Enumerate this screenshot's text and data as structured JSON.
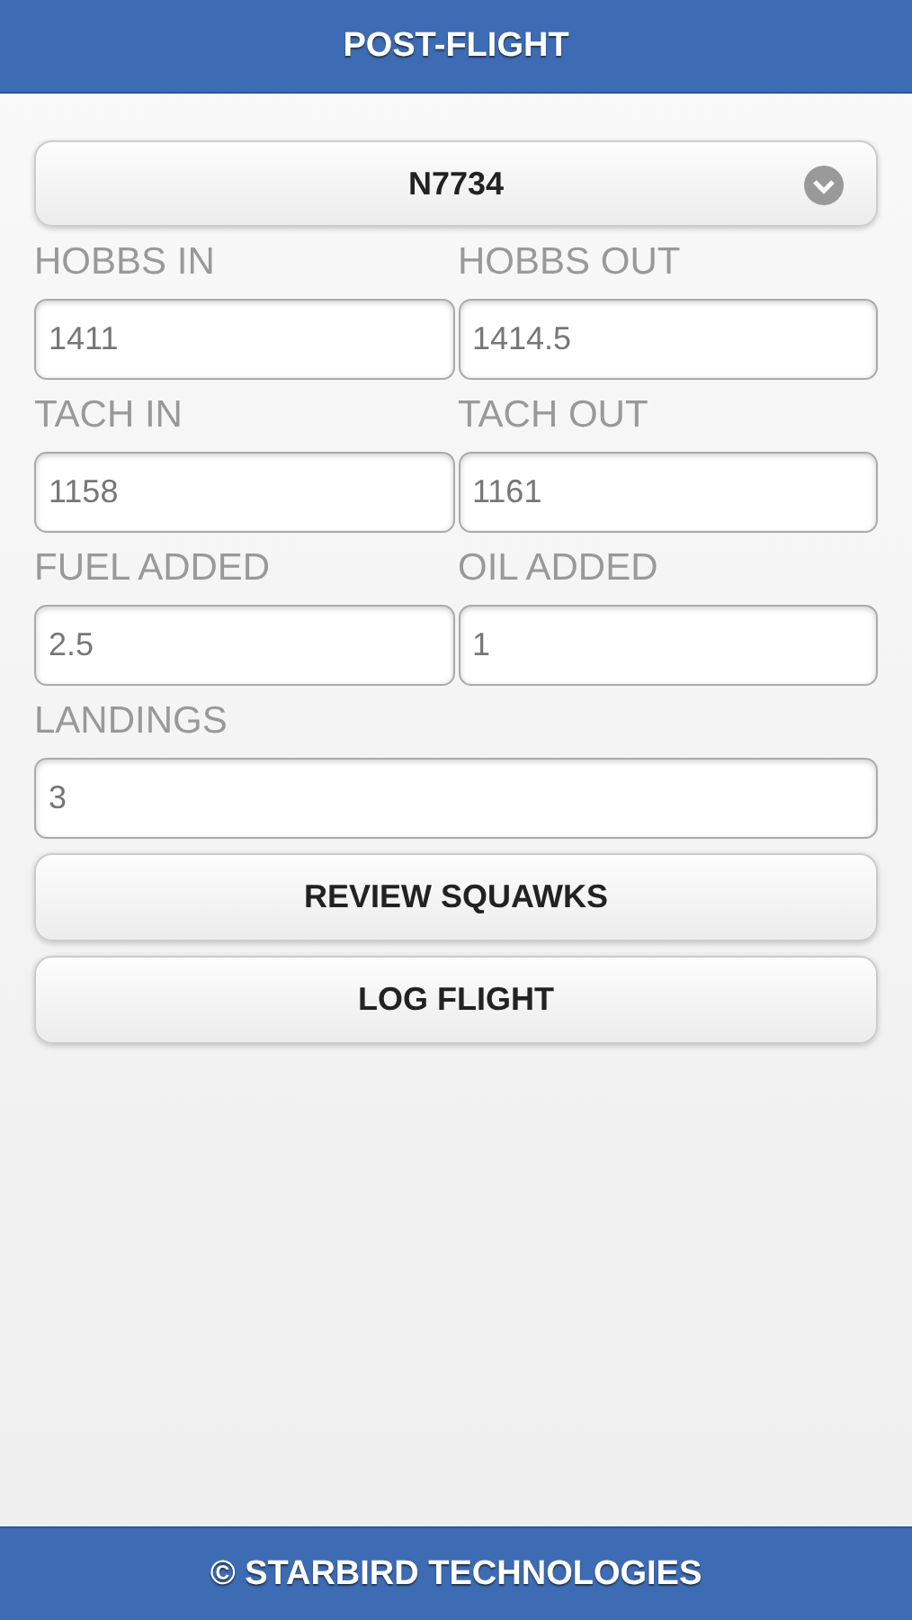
{
  "header": {
    "title": "POST-FLIGHT"
  },
  "aircraft_select": {
    "value": "N7734"
  },
  "fields": [
    {
      "kind": "half",
      "label": "HOBBS IN",
      "value": "1411"
    },
    {
      "kind": "half",
      "label": "HOBBS OUT",
      "value": "1414.5"
    },
    {
      "kind": "half",
      "label": "TACH IN",
      "value": "1158"
    },
    {
      "kind": "half",
      "label": "TACH OUT",
      "value": "1161"
    },
    {
      "kind": "half",
      "label": "FUEL ADDED",
      "value": "2.5"
    },
    {
      "kind": "half",
      "label": "OIL ADDED",
      "value": "1"
    },
    {
      "kind": "full",
      "label": "LANDINGS",
      "value": "3"
    }
  ],
  "buttons": [
    "REVIEW SQUAWKS",
    "LOG FLIGHT"
  ],
  "footer": {
    "text": "© STARBIRD TECHNOLOGIES"
  }
}
